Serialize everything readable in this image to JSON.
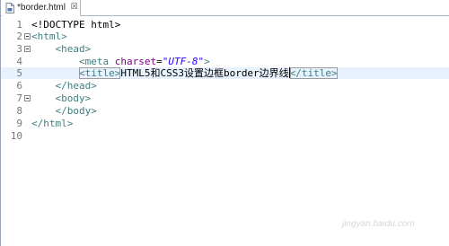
{
  "tab": {
    "label": "*border.html",
    "close_symbol": "☒",
    "icon": "html-file-icon"
  },
  "editor": {
    "lines": [
      {
        "num": "1",
        "fold": false,
        "indent": "",
        "parts": [
          {
            "t": "doctype",
            "v": "<!DOCTYPE html>"
          }
        ]
      },
      {
        "num": "2",
        "fold": true,
        "indent": "",
        "parts": [
          {
            "t": "tag",
            "v": "<html>"
          }
        ]
      },
      {
        "num": "3",
        "fold": true,
        "indent": "    ",
        "parts": [
          {
            "t": "tag",
            "v": "<head>"
          }
        ]
      },
      {
        "num": "4",
        "fold": false,
        "indent": "        ",
        "parts": [
          {
            "t": "tag",
            "v": "<meta "
          },
          {
            "t": "attr",
            "v": "charset"
          },
          {
            "t": "text",
            "v": "="
          },
          {
            "t": "val",
            "v": "\"UTF-8\""
          },
          {
            "t": "tag",
            "v": ">"
          }
        ]
      },
      {
        "num": "5",
        "fold": false,
        "indent": "        ",
        "current": true,
        "parts": [
          {
            "t": "tag boxed",
            "v": "<title>"
          },
          {
            "t": "text",
            "v": "HTML5和CSS3设置边框border边界线"
          },
          {
            "t": "cursor",
            "v": ""
          },
          {
            "t": "tag boxed",
            "v": "</title>"
          }
        ]
      },
      {
        "num": "6",
        "fold": false,
        "indent": "    ",
        "parts": [
          {
            "t": "tag",
            "v": "</head>"
          }
        ]
      },
      {
        "num": "7",
        "fold": true,
        "indent": "    ",
        "parts": [
          {
            "t": "tag",
            "v": "<body>"
          }
        ]
      },
      {
        "num": "8",
        "fold": false,
        "indent": "    ",
        "parts": [
          {
            "t": "tag",
            "v": "</body>"
          }
        ]
      },
      {
        "num": "9",
        "fold": false,
        "indent": "",
        "parts": [
          {
            "t": "tag",
            "v": "</html>"
          }
        ]
      },
      {
        "num": "10",
        "fold": false,
        "indent": "",
        "parts": []
      }
    ]
  },
  "watermark": "jingyan.baidu.com"
}
